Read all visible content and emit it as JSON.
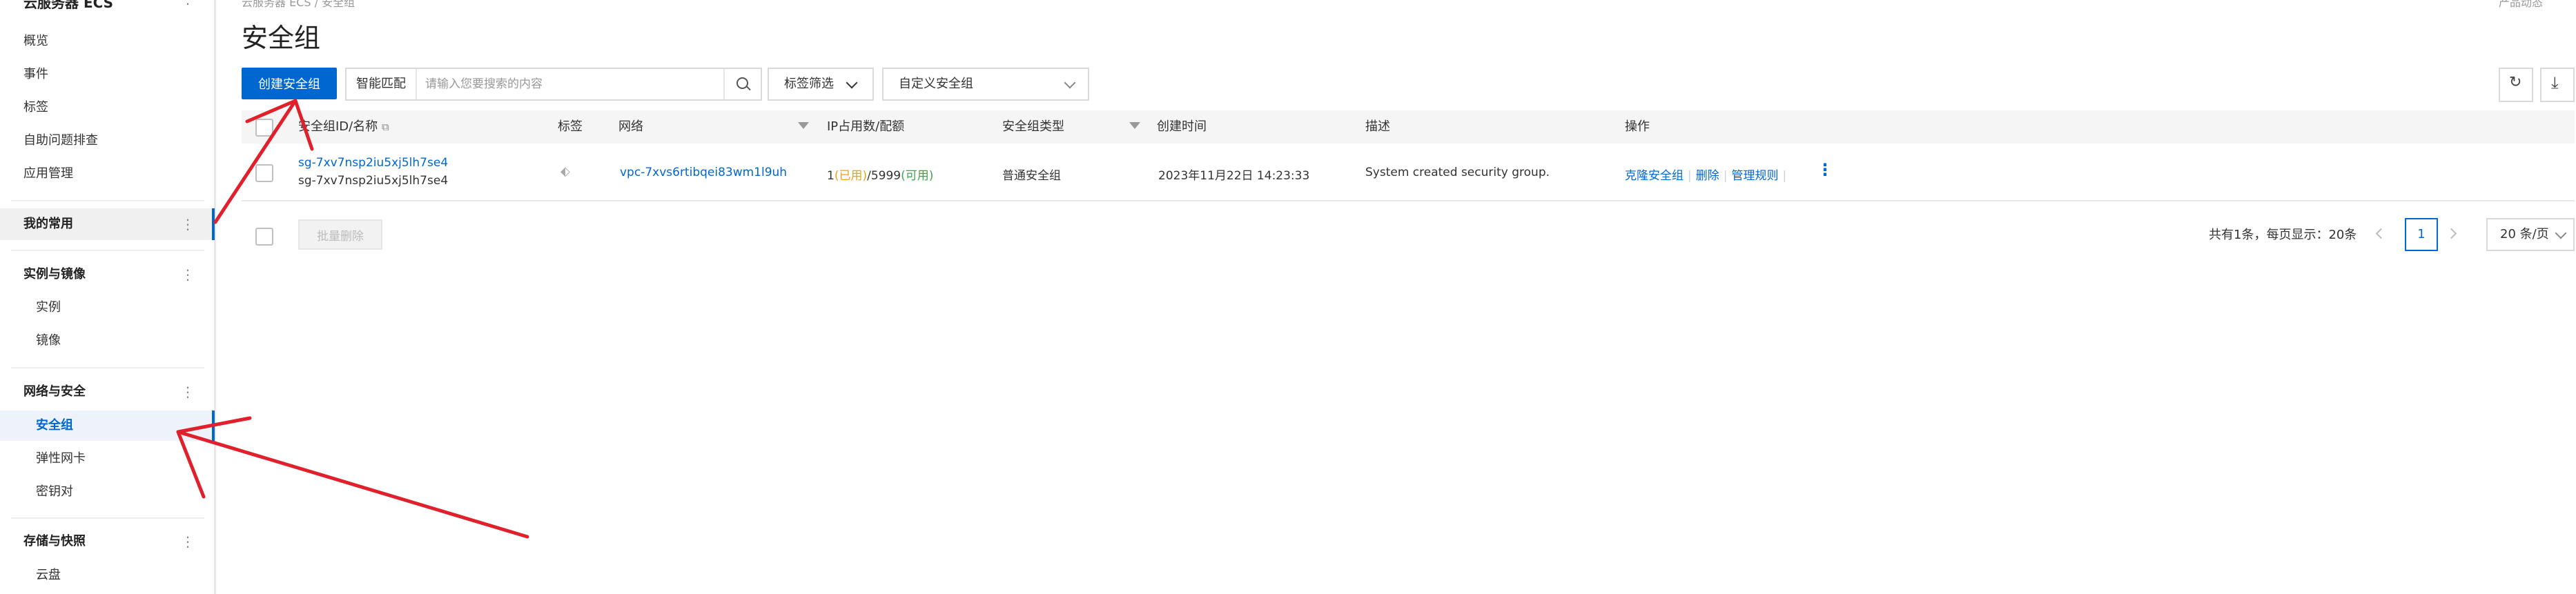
{
  "sidebar": {
    "service_title": "云服务器 ECS",
    "items_top": [
      "概览",
      "事件",
      "标签",
      "自助问题排查",
      "应用管理"
    ],
    "favorites_label": "我的常用",
    "groups": [
      {
        "label": "实例与镜像",
        "items": [
          "实例",
          "镜像"
        ]
      },
      {
        "label": "网络与安全",
        "items": [
          "安全组",
          "弹性网卡",
          "密钥对"
        ]
      },
      {
        "label": "存储与快照",
        "items": [
          "云盘"
        ]
      }
    ],
    "more_glyph": "⋮"
  },
  "breadcrumb": "云服务器 ECS / 安全组",
  "top_right": "产品动态",
  "page_title": "安全组",
  "toolbar": {
    "create_label": "创建安全组",
    "search_mode": "智能匹配",
    "search_placeholder": "请输入您要搜索的内容",
    "tag_filter_label": "标签筛选",
    "custom_group_label": "自定义安全组"
  },
  "table": {
    "headers": {
      "id_name": "安全组ID/名称",
      "tag": "标签",
      "network": "网络",
      "ip": "IP占用数/配额",
      "type": "安全组类型",
      "created": "创建时间",
      "desc": "描述",
      "ops": "操作"
    },
    "rows": [
      {
        "id": "sg-7xv7nsp2iu5xj5lh7se4",
        "name": "sg-7xv7nsp2iu5xj5lh7se4",
        "network": "vpc-7xvs6rtibqei83wm1l9uh",
        "ip_used": "1",
        "ip_used_label": "(已用)",
        "ip_quota": "/5999",
        "ip_avail_label": "(可用)",
        "type": "普通安全组",
        "created": "2023年11月22日 14:23:33",
        "desc": "System created security group.",
        "op_clone": "克隆安全组",
        "op_delete": "删除",
        "op_rules": "管理规则"
      }
    ]
  },
  "batch_delete_label": "批量删除",
  "pagination": {
    "summary": "共有1条，每页显示：20条",
    "current_page": "1",
    "page_size": "20 条/页"
  },
  "colors": {
    "primary": "#0067d1",
    "annotation_arrow": "#e0202a"
  }
}
